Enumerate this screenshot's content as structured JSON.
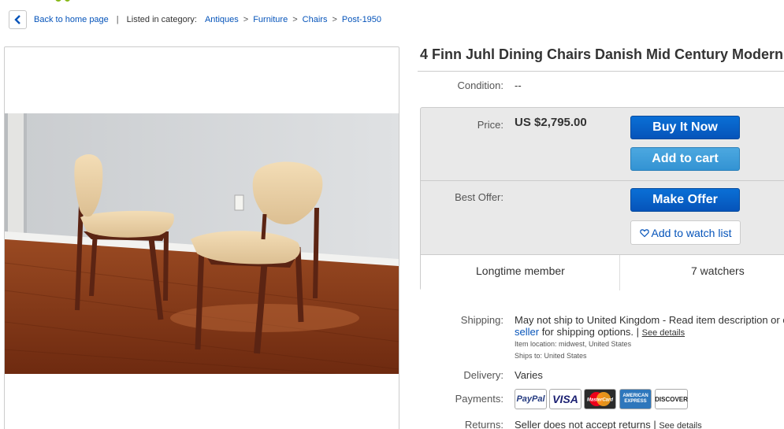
{
  "breadcrumb": {
    "back_label": "Back to home page",
    "listed_label": "Listed in category:",
    "items": [
      "Antiques",
      "Furniture",
      "Chairs",
      "Post-1950"
    ],
    "separator": ">"
  },
  "listing": {
    "title": "4 Finn Juhl Dining Chairs Danish Mid Century Modern",
    "condition_label": "Condition:",
    "condition_value": "--"
  },
  "price_box": {
    "price_label": "Price:",
    "price_value": "US $2,795.00",
    "buy_now": "Buy It Now",
    "add_to_cart": "Add to cart",
    "best_offer_label": "Best Offer:",
    "make_offer": "Make Offer",
    "watch_list": "Add to watch list",
    "member_status": "Longtime member",
    "watchers": "7 watchers"
  },
  "shipping": {
    "label": "Shipping:",
    "line1": "May not ship to United Kingdom - Read item description or c",
    "seller_link": "seller",
    "line2_rest": " for shipping options. |",
    "see_details": "See details",
    "item_location": "Item location:  midwest, United States",
    "ships_to": "Ships to:  United States"
  },
  "delivery": {
    "label": "Delivery:",
    "value": "Varies"
  },
  "payments": {
    "label": "Payments:",
    "methods": [
      "PayPal",
      "VISA",
      "MasterCard",
      "AMERICAN EXPRESS",
      "DISCOVER"
    ]
  },
  "returns": {
    "label": "Returns:",
    "value": "Seller does not accept returns |",
    "see_details": "See details"
  },
  "colors": {
    "link": "#0654ba",
    "buy_button": "#0654ba",
    "cart_button": "#3393d3",
    "panel_bg": "#e9e9e9"
  }
}
